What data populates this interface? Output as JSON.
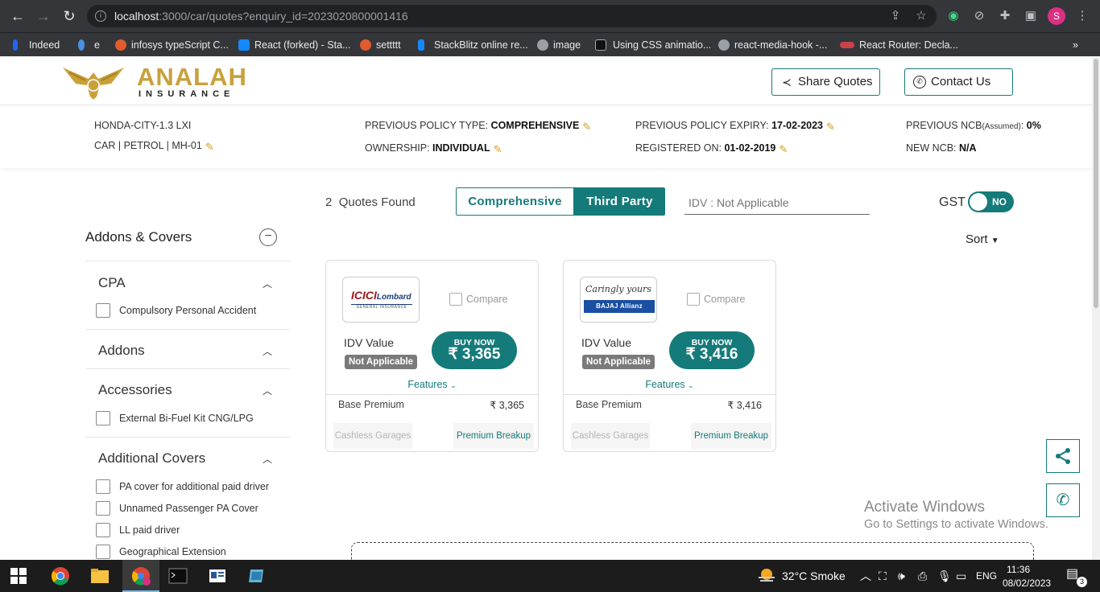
{
  "browser": {
    "url_host": "localhost",
    "url_rest": ":3000/car/quotes?enquiry_id=2023020800001416",
    "avatar_letter": "S",
    "bookmarks": [
      {
        "label": "Indeed",
        "color": "#2164f3"
      },
      {
        "label": "e",
        "color": "#4a90e2"
      },
      {
        "label": "infosys typeScript C...",
        "color": "#e15b2d"
      },
      {
        "label": "React (forked) - Sta...",
        "color": "#1389fd"
      },
      {
        "label": "settttt",
        "color": "#e15b2d"
      },
      {
        "label": "StackBlitz online re...",
        "color": "#1389fd"
      },
      {
        "label": "image",
        "color": "#9aa0a6"
      },
      {
        "label": "Using CSS animatio...",
        "color": "#111111"
      },
      {
        "label": "react-media-hook -...",
        "color": "#9aa0a6"
      },
      {
        "label": "React Router: Decla...",
        "color": "#ca4245"
      }
    ]
  },
  "header": {
    "brand_name": "ANALAH",
    "brand_sub": "INSURANCE",
    "share_label": "Share Quotes",
    "contact_label": "Contact Us"
  },
  "vehicle": {
    "model": "HONDA-CITY-1.3 LXI",
    "details": "CAR | PETROL | MH-01",
    "prev_policy_type_label": "PREVIOUS POLICY TYPE: ",
    "prev_policy_type": "COMPREHENSIVE",
    "ownership_label": "OWNERSHIP: ",
    "ownership": "INDIVIDUAL",
    "prev_expiry_label": "PREVIOUS POLICY EXPIRY: ",
    "prev_expiry": "17-02-2023",
    "registered_label": "REGISTERED ON: ",
    "registered": "01-02-2019",
    "prev_ncb_label": "PREVIOUS NCB",
    "prev_ncb_assumed": "(Assumed)",
    "prev_ncb_suffix": ": ",
    "prev_ncb": "0%",
    "new_ncb_label": "NEW NCB: ",
    "new_ncb": "N/A"
  },
  "filters": {
    "title": "Addons & Covers",
    "sections": [
      {
        "title": "CPA",
        "items": [
          "Compulsory Personal Accident"
        ]
      },
      {
        "title": "Addons",
        "items": []
      },
      {
        "title": "Accessories",
        "items": [
          "External Bi-Fuel Kit CNG/LPG"
        ]
      },
      {
        "title": "Additional Covers",
        "items": [
          "PA cover for additional paid driver",
          "Unnamed Passenger PA Cover",
          "LL paid driver",
          "Geographical Extension"
        ]
      }
    ]
  },
  "toolbar": {
    "quotes_count": "2",
    "quotes_label": "Quotes Found",
    "plan_options": [
      "Comprehensive",
      "Third Party"
    ],
    "active_plan": "Third Party",
    "idv_placeholder": "IDV : Not Applicable",
    "gst_label": "GST",
    "gst_value": "NO",
    "sort_label": "Sort"
  },
  "quotes": [
    {
      "insurer": "ICICI Lombard",
      "logo_main": "ICICI",
      "logo_accent": "Lombard",
      "logo_sub": "GENERAL INSURANCE",
      "compare_label": "Compare",
      "idv_label": "IDV Value",
      "idv_value": "Not Applicable",
      "buy_label": "BUY NOW",
      "price": "₹ 3,365",
      "features_label": "Features",
      "base_premium_label": "Base Premium",
      "base_premium": "₹ 3,365",
      "cashless_label": "Cashless Garages",
      "breakup_label": "Premium Breakup"
    },
    {
      "insurer": "Bajaj Allianz",
      "logo_main": "Caringly yours",
      "logo_accent": "BAJAJ Allianz",
      "logo_sub": "",
      "compare_label": "Compare",
      "idv_label": "IDV Value",
      "idv_value": "Not Applicable",
      "buy_label": "BUY NOW",
      "price": "₹ 3,416",
      "features_label": "Features",
      "base_premium_label": "Base Premium",
      "base_premium": "₹ 3,416",
      "cashless_label": "Cashless Garages",
      "breakup_label": "Premium Breakup"
    }
  ],
  "watermark": {
    "line1": "Activate Windows",
    "line2": "Go to Settings to activate Windows."
  },
  "taskbar": {
    "weather": "32°C  Smoke",
    "language": "ENG",
    "time": "11:36",
    "date": "08/02/2023",
    "notifications": "3"
  },
  "colors": {
    "brand_teal": "#157a7a",
    "brand_gold": "#c9a13b",
    "edit_icon": "#d4a017"
  }
}
